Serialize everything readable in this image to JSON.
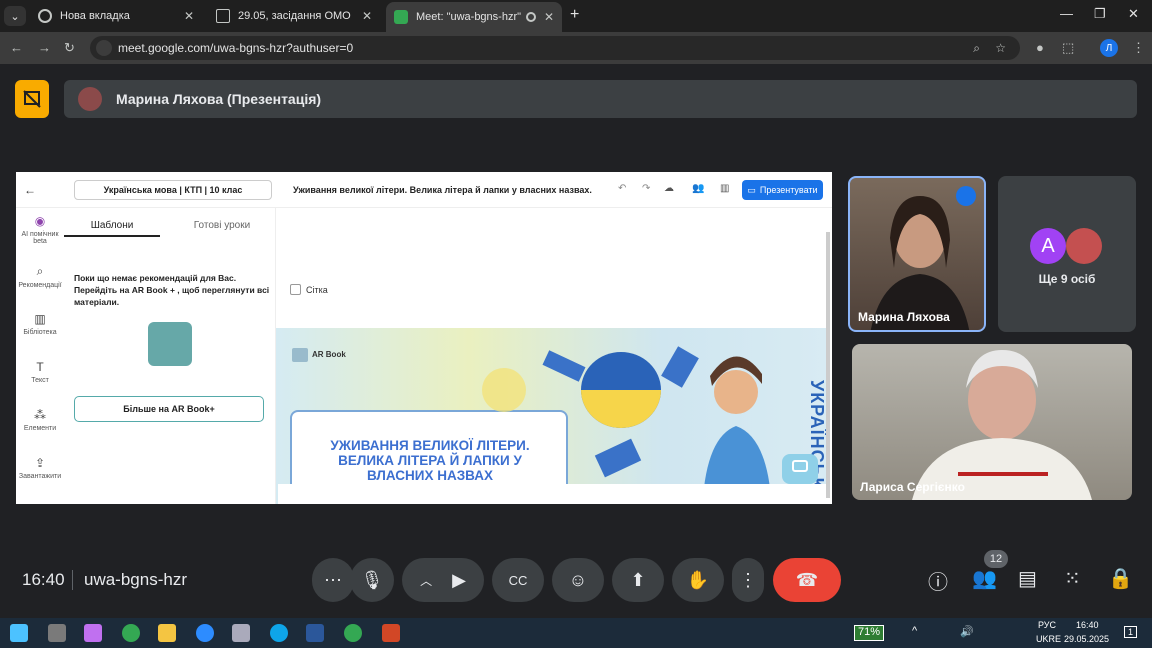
{
  "browser": {
    "tabs": [
      {
        "title": "Нова вкладка"
      },
      {
        "title": "29.05, засідання ОМО"
      },
      {
        "title": "Meet: \"uwa-bgns-hzr\""
      }
    ],
    "url": "meet.google.com/uwa-bgns-hzr?authuser=0",
    "profile_initial": "Л"
  },
  "meet": {
    "presenter_banner": "Марина Ляхова (Презентація)",
    "time": "16:40",
    "meeting_code": "uwa-bgns-hzr",
    "participants_count": "12",
    "more_people": "Ще 9 осіб",
    "avatar_letter": "A",
    "tiles": [
      {
        "name": "Марина Ляхова"
      },
      {
        "name": "Лариса Сергієнко"
      }
    ]
  },
  "shared": {
    "doc_title": "Українська мова | КТП | 10 клас",
    "lesson_title": "Уживання великої літери. Велика літера й лапки у власних назвах.",
    "present_button": "Презентувати",
    "sidebar": [
      {
        "label": "AI помічник",
        "sub": "beta"
      },
      {
        "label": "Рекомендації"
      },
      {
        "label": "Бібліотека"
      },
      {
        "label": "Текст"
      },
      {
        "label": "Елементи"
      },
      {
        "label": "Завантажити"
      }
    ],
    "tabs": [
      "Шаблони",
      "Готові уроки"
    ],
    "recommendation_text": "Поки що немає рекомендацій для Вас. Перейдіть на AR Book + , щоб переглянути всі матеріали.",
    "more_button": "Більше на AR Book+",
    "grid_label": "Сітка",
    "slide": {
      "brand": "AR Book",
      "heading": "УЖИВАННЯ ВЕЛИКОЇ ЛІТЕРИ. ВЕЛИКА ЛІТЕРА Й ЛАПКИ У ВЛАСНИХ НАЗВАХ",
      "vertical": "УКРАЇНСЬК"
    }
  },
  "taskbar": {
    "battery": "71%",
    "lang": "РУС",
    "lang2": "UKRE",
    "time": "16:40",
    "date": "29.05.2025",
    "notif": "1"
  },
  "colors": {
    "accent": "#1a73e8",
    "hangup": "#ea4335",
    "present": "#f9ab00"
  }
}
